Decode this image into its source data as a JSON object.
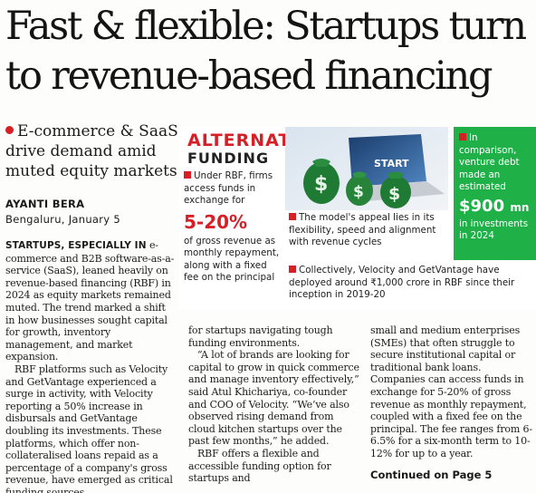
{
  "headline": {
    "line1": "Fast & flexible: Startups turn",
    "line2": "to revenue-based financing"
  },
  "deck": "E-commerce & SaaS drive demand amid muted equity markets",
  "byline": {
    "name": "AYANTI BERA",
    "place": "Bengaluru, January 5"
  },
  "column1": {
    "lead": "STARTUPS, ESPECIALLY IN",
    "p1_rest": " e-commerce and B2B software-as-a-service (SaaS), leaned heavily on revenue-based financing (RBF) in 2024 as equity markets remained muted. The trend marked a shift in how businesses sought capital for growth, inventory management, and market expansion.",
    "p2": "RBF platforms such as Velocity and GetVantage experienced a surge in activity, with Velocity reporting a 50% increase in disbursals and GetVantage doubling its investments. These platforms, which offer non-collateralised loans repaid as a percentage of a company's gross revenue, have emerged as critical funding sources"
  },
  "column2": {
    "p1": "for startups navigating tough funding environments.",
    "p2": "“A lot of brands are looking for capital to grow in quick commerce and manage inventory effectively,” said Atul Khichariya, co-founder and COO of Velocity. “We’ve also observed rising demand from cloud kitchen startups over the past few months,” he added.",
    "p3": "RBF offers a flexible and accessible funding option for startups and"
  },
  "column3": {
    "p1": "small and medium enterprises (SMEs) that often struggle to secure institutional capital or traditional bank loans. Companies can access funds in exchange for 5-20% of gross revenue as monthly repayment, coupled with a fixed fee on the principal. The fee ranges from 6-6.5% for a six-month term to 10-12% for up to a year."
  },
  "continued": "Continued on Page 5",
  "infobox": {
    "title_line1": "ALTERNATIVE",
    "title_line2": "FUNDING",
    "item1_before": "Under RBF, firms access funds in exchange for",
    "item1_big": "5-20%",
    "item1_after": "of gross revenue as monthly repayment, along with a fixed fee on the principal",
    "item2": "The model's appeal lies in its flexibility, speed and alignment with revenue cycles",
    "item3": "Collectively, Velocity and GetVantage have deployed around ₹1,000 crore in RBF since their inception in 2019-20",
    "green_before": "In comparison, venture debt made an estimated",
    "green_big": "$900",
    "green_unit": "mn",
    "green_after": "in investments in 2024",
    "illustration_label": "START"
  },
  "colors": {
    "red": "#d71f26",
    "green": "#1fb148",
    "text": "#1a1a1a"
  }
}
